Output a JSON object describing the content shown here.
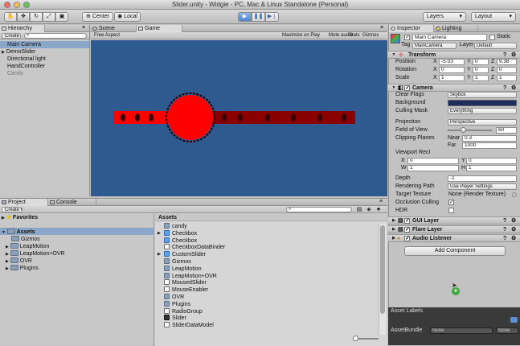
{
  "window": {
    "title": "Slider.unity - Widgie - PC, Mac & Linux Standalone (Personal)"
  },
  "toolbar": {
    "tools": [
      "hand-tool",
      "move-tool",
      "rotate-tool",
      "scale-tool",
      "rect-tool"
    ],
    "pivot_label": "Center",
    "space_label": "Local",
    "layers_label": "Layers",
    "layout_label": "Layout"
  },
  "hierarchy": {
    "tab_label": "Hierarchy",
    "create_label": "Create",
    "search_placeholder": "",
    "items": [
      "Main Camera",
      "DemoSlider",
      "Directional light",
      "HandController",
      "Candy"
    ]
  },
  "scene": {
    "tab_label": "Scene"
  },
  "game": {
    "tab_label": "Game",
    "aspect_label": "Free Aspect",
    "maximize_label": "Maximize on Play",
    "mute_label": "Mute audio",
    "stats_label": "Stats",
    "gizmos_label": "Gizmos",
    "bg_color": "#2e5a90",
    "slider_color": "#ff0000",
    "slider_dark_color": "#8a0000",
    "handle_ring_color": "#220000"
  },
  "inspector": {
    "tab_label": "Inspector",
    "lighting_tab_label": "Lighting",
    "object_name": "Main Camera",
    "static_label": "Static",
    "tag_label": "Tag",
    "tag_value": "MainCamera",
    "layer_label": "Layer",
    "layer_value": "Default",
    "transform": {
      "title": "Transform",
      "position_label": "Position",
      "rotation_label": "Rotation",
      "scale_label": "Scale",
      "position": {
        "x": "-5.03",
        "y": "0",
        "z": "9.38"
      },
      "rotation": {
        "x": "0",
        "y": "0",
        "z": "0"
      },
      "scale": {
        "x": "1",
        "y": "1",
        "z": "1"
      },
      "x_label": "X",
      "y_label": "Y",
      "z_label": "Z"
    },
    "camera": {
      "title": "Camera",
      "clear_flags_label": "Clear Flags",
      "clear_flags_value": "Skybox",
      "background_label": "Background",
      "background_color": "#1d2e5c",
      "culling_mask_label": "Culling Mask",
      "culling_mask_value": "Everything",
      "projection_label": "Projection",
      "projection_value": "Perspective",
      "fov_label": "Field of View",
      "fov_value": "60",
      "fov_fraction": 0.33,
      "clipping_label": "Clipping Planes",
      "near_label": "Near",
      "near_value": "0.3",
      "far_label": "Far",
      "far_value": "1000",
      "viewport_label": "Viewport Rect",
      "vx_label": "X",
      "vx_value": "0",
      "vy_label": "Y",
      "vy_value": "0",
      "vw_label": "W",
      "vw_value": "1",
      "vh_label": "H",
      "vh_value": "1",
      "depth_label": "Depth",
      "depth_value": "-1",
      "rendering_path_label": "Rendering Path",
      "rendering_path_value": "Use Player Settings",
      "target_texture_label": "Target Texture",
      "target_texture_value": "None (Render Texture)",
      "occlusion_label": "Occlusion Culling",
      "hdr_label": "HDR"
    },
    "gui_layer_title": "GUI Layer",
    "flare_layer_title": "Flare Layer",
    "audio_listener_title": "Audio Listener",
    "add_component_label": "Add Component",
    "asset_labels_title": "Asset Labels",
    "asset_bundle_label": "AssetBundle",
    "asset_bundle_value": "None",
    "asset_bundle_variant": "None"
  },
  "project": {
    "tab_label": "Project",
    "console_tab_label": "Console",
    "create_label": "Create",
    "favorites_label": "Favorites",
    "tree": [
      {
        "label": "Assets",
        "level": 0
      },
      {
        "label": "Gizmos",
        "level": 1
      },
      {
        "label": "LeapMotion",
        "level": 1
      },
      {
        "label": "LeapMotion+OVR",
        "level": 1
      },
      {
        "label": "OVR",
        "level": 1
      },
      {
        "label": "Plugins",
        "level": 1
      }
    ],
    "assets_header": "Assets",
    "assets": [
      {
        "label": "candy",
        "icon": "folder"
      },
      {
        "label": "Checkbox",
        "icon": "prefab"
      },
      {
        "label": "Checkbox",
        "icon": "prefab"
      },
      {
        "label": "CheckboxDataBinder",
        "icon": "script"
      },
      {
        "label": "CustomSlider",
        "icon": "prefab"
      },
      {
        "label": "Gizmos",
        "icon": "folder"
      },
      {
        "label": "LeapMotion",
        "icon": "folder"
      },
      {
        "label": "LeapMotion+OVR",
        "icon": "folder"
      },
      {
        "label": "MousedSlider",
        "icon": "script"
      },
      {
        "label": "MouseEnabler",
        "icon": "script"
      },
      {
        "label": "OVR",
        "icon": "folder"
      },
      {
        "label": "Plugins",
        "icon": "folder"
      },
      {
        "label": "RadioGroup",
        "icon": "script"
      },
      {
        "label": "Slider",
        "icon": "unity"
      },
      {
        "label": "SliderDataModel",
        "icon": "script"
      }
    ]
  }
}
